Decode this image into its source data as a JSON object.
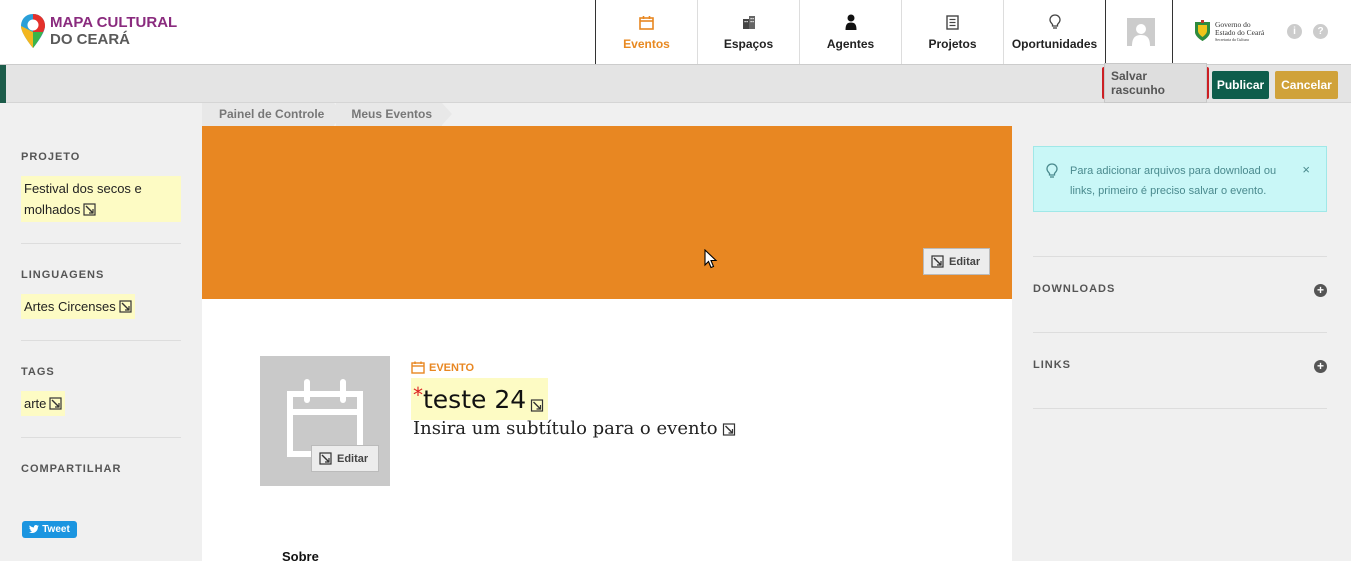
{
  "header": {
    "logo_line1": "MAPA CULTURAL",
    "logo_line2": "DO CEARÁ",
    "nav": [
      {
        "label": "Eventos",
        "icon": "calendar-icon",
        "active": true
      },
      {
        "label": "Espaços",
        "icon": "building-icon",
        "active": false
      },
      {
        "label": "Agentes",
        "icon": "person-icon",
        "active": false
      },
      {
        "label": "Projetos",
        "icon": "document-icon",
        "active": false
      },
      {
        "label": "Oportunidades",
        "icon": "lightbulb-icon",
        "active": false
      }
    ],
    "gov_line1": "Governo do",
    "gov_line2": "Estado do Ceará",
    "gov_line3": "Secretaria da Cultura",
    "info_icon": "i",
    "help_icon": "?"
  },
  "toolbar": {
    "save_draft_label": "Salvar rascunho",
    "publish_label": "Publicar",
    "cancel_label": "Cancelar"
  },
  "breadcrumb": [
    "Painel de Controle",
    "Meus Eventos"
  ],
  "sidebar": {
    "projeto_title": "PROJETO",
    "projeto_value": "Festival dos secos e molhados",
    "linguagens_title": "LINGUAGENS",
    "linguagens_value": "Artes Circenses",
    "tags_title": "TAGS",
    "tags_value": "arte",
    "compartilhar_title": "COMPARTILHAR",
    "tweet_label": "Tweet"
  },
  "main": {
    "cover_edit_label": "Editar",
    "thumb_edit_label": "Editar",
    "type_label": "EVENTO",
    "required_mark": "*",
    "title": "teste 24",
    "subtitle": "Insira um subtítulo para o evento",
    "about_label": "Sobre"
  },
  "right": {
    "alert_text": "Para adicionar arquivos para download ou links, primeiro é preciso salvar o evento.",
    "alert_close": "×",
    "downloads_title": "DOWNLOADS",
    "links_title": "LINKS",
    "add_symbol": "+"
  },
  "colors": {
    "accent_orange": "#e88722",
    "publish_green": "#0e5d4b",
    "cancel_gold": "#d0a23a",
    "highlight_yellow": "#fdfbc4",
    "alert_cyan": "#c9f7f7",
    "draft_outline_red": "#cc1f24"
  }
}
